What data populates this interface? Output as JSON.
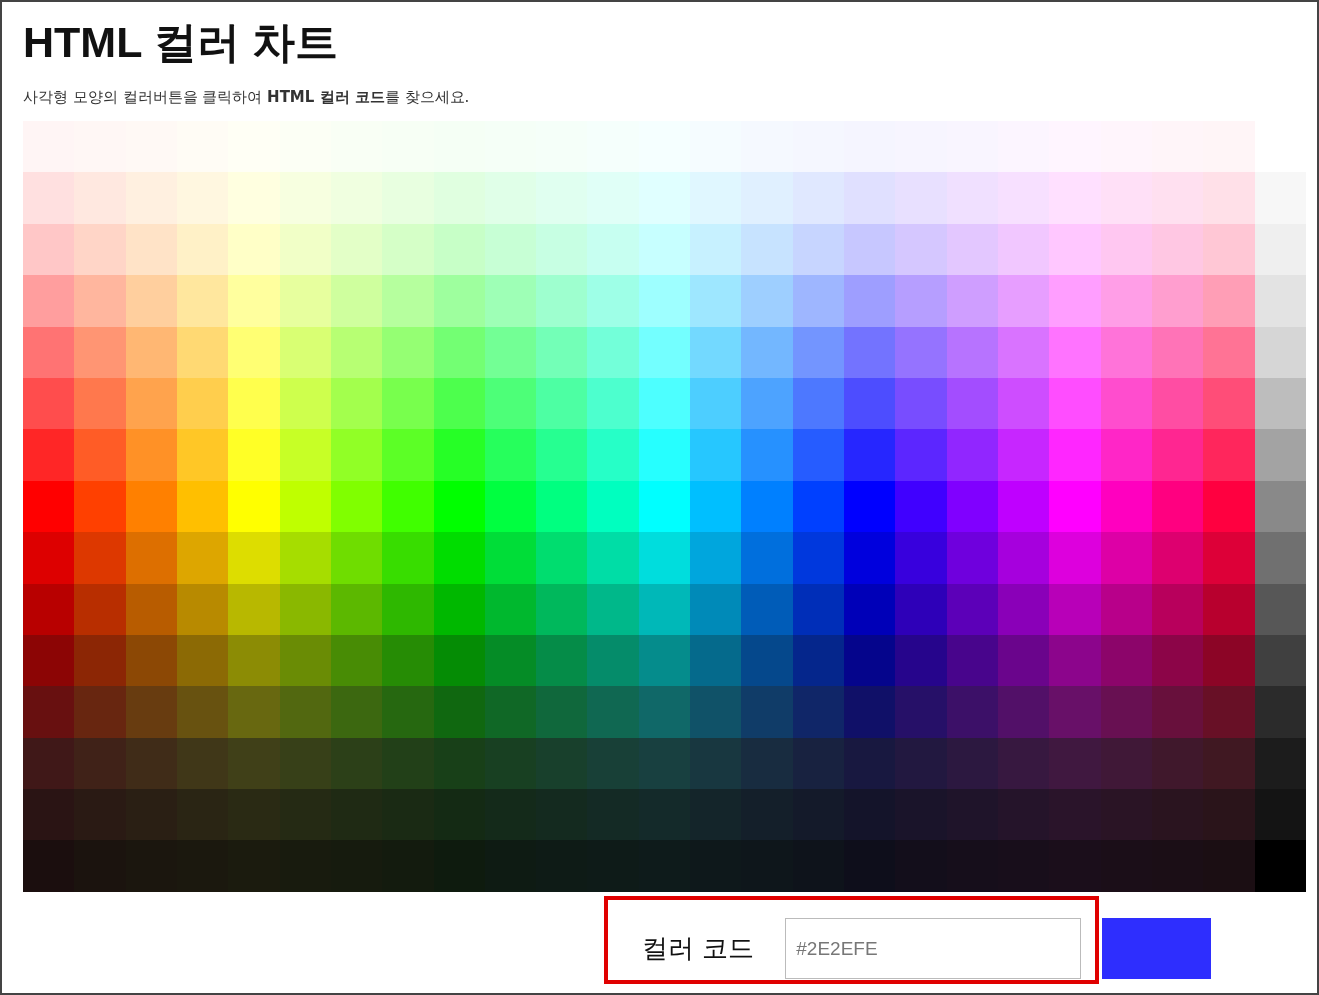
{
  "title": "HTML 컬러 차트",
  "description": "사각형 모양의 컬러버튼을 클릭하여 **HTML 컬러 코드**를 찾으세요.",
  "grid": {
    "rows": [
      {
        "swatches": [
          {
            "color": "#FFF5F5"
          },
          {
            "color": "#FFF7F5"
          },
          {
            "color": "#FFF9F5"
          },
          {
            "color": "#FFFCF5"
          },
          {
            "color": "#FFFFF5"
          },
          {
            "color": "#FCFFF5"
          },
          {
            "color": "#F9FFF5"
          },
          {
            "color": "#F7FFF5"
          },
          {
            "color": "#F5FFF5"
          },
          {
            "color": "#F5FFF7"
          },
          {
            "color": "#F5FFF9"
          },
          {
            "color": "#F5FFFC"
          },
          {
            "color": "#F5FFFF"
          },
          {
            "color": "#F5FCFF"
          },
          {
            "color": "#F5F9FF"
          },
          {
            "color": "#F5F7FF"
          },
          {
            "color": "#F5F5FF"
          },
          {
            "color": "#F7F5FF"
          },
          {
            "color": "#F9F5FF"
          },
          {
            "color": "#FCF5FF"
          },
          {
            "color": "#FFF5FF"
          },
          {
            "color": "#FFF5FC"
          },
          {
            "color": "#FFF5F9"
          },
          {
            "color": "#FFF5F7"
          }
        ]
      },
      {
        "swatches": [
          {
            "color": "#FFE0E0"
          },
          {
            "color": "#FFE8E0"
          },
          {
            "color": "#FFF0E0"
          },
          {
            "color": "#FFF7E0"
          },
          {
            "color": "#FFFFE0"
          },
          {
            "color": "#F7FFE0"
          },
          {
            "color": "#F0FFE0"
          },
          {
            "color": "#E8FFE0"
          },
          {
            "color": "#E0FFE0"
          },
          {
            "color": "#E0FFE8"
          },
          {
            "color": "#E0FFF0"
          },
          {
            "color": "#E0FFF7"
          },
          {
            "color": "#E0FFFF"
          },
          {
            "color": "#E0F7FF"
          },
          {
            "color": "#E0F0FF"
          },
          {
            "color": "#E0E8FF"
          },
          {
            "color": "#E0E0FF"
          },
          {
            "color": "#E8E0FF"
          },
          {
            "color": "#F0E0FF"
          },
          {
            "color": "#F7E0FF"
          },
          {
            "color": "#FFE0FF"
          },
          {
            "color": "#FFE0F7"
          },
          {
            "color": "#FFE0F0"
          },
          {
            "color": "#FFE0E8"
          },
          {
            "color": "#F7F7F7"
          }
        ]
      },
      {
        "swatches": [
          {
            "color": "#FFC7C7"
          },
          {
            "color": "#FFD5C7"
          },
          {
            "color": "#FFE3C7"
          },
          {
            "color": "#FFF1C7"
          },
          {
            "color": "#FFFFC7"
          },
          {
            "color": "#F1FFC7"
          },
          {
            "color": "#E3FFC7"
          },
          {
            "color": "#D5FFC7"
          },
          {
            "color": "#C7FFC7"
          },
          {
            "color": "#C7FFD5"
          },
          {
            "color": "#C7FFE3"
          },
          {
            "color": "#C7FFF1"
          },
          {
            "color": "#C7FFFF"
          },
          {
            "color": "#C7F1FF"
          },
          {
            "color": "#C7E3FF"
          },
          {
            "color": "#C7D5FF"
          },
          {
            "color": "#C7C7FF"
          },
          {
            "color": "#D5C7FF"
          },
          {
            "color": "#E3C7FF"
          },
          {
            "color": "#F1C7FF"
          },
          {
            "color": "#FFC7FF"
          },
          {
            "color": "#FFC7F1"
          },
          {
            "color": "#FFC7E3"
          },
          {
            "color": "#FFC7D5"
          },
          {
            "color": "#EFEFEF"
          }
        ]
      },
      {
        "swatches": [
          {
            "color": "#FF9E9E"
          },
          {
            "color": "#FFB69E"
          },
          {
            "color": "#FFCF9E"
          },
          {
            "color": "#FFE79E"
          },
          {
            "color": "#FFFF9E"
          },
          {
            "color": "#E7FF9E"
          },
          {
            "color": "#CFFF9E"
          },
          {
            "color": "#B6FF9E"
          },
          {
            "color": "#9EFF9E"
          },
          {
            "color": "#9EFFB6"
          },
          {
            "color": "#9EFFCF"
          },
          {
            "color": "#9EFFE7"
          },
          {
            "color": "#9EFFFF"
          },
          {
            "color": "#9EE7FF"
          },
          {
            "color": "#9ECFFF"
          },
          {
            "color": "#9EB6FF"
          },
          {
            "color": "#9E9EFF"
          },
          {
            "color": "#B69EFF"
          },
          {
            "color": "#CF9EFF"
          },
          {
            "color": "#E79EFF"
          },
          {
            "color": "#FF9EFF"
          },
          {
            "color": "#FF9EE7"
          },
          {
            "color": "#FF9ECF"
          },
          {
            "color": "#FF9EB6"
          },
          {
            "color": "#E3E3E3"
          }
        ]
      },
      {
        "swatches": [
          {
            "color": "#FF7373"
          },
          {
            "color": "#FF9573"
          },
          {
            "color": "#FFB773"
          },
          {
            "color": "#FFD973"
          },
          {
            "color": "#FFFF73"
          },
          {
            "color": "#D9FF73"
          },
          {
            "color": "#B7FF73"
          },
          {
            "color": "#95FF73"
          },
          {
            "color": "#73FF73"
          },
          {
            "color": "#73FF95"
          },
          {
            "color": "#73FFB7"
          },
          {
            "color": "#73FFD9"
          },
          {
            "color": "#73FFFF"
          },
          {
            "color": "#73D9FF"
          },
          {
            "color": "#73B7FF"
          },
          {
            "color": "#7395FF"
          },
          {
            "color": "#7373FF"
          },
          {
            "color": "#9573FF"
          },
          {
            "color": "#B773FF"
          },
          {
            "color": "#D973FF"
          },
          {
            "color": "#FF73FF"
          },
          {
            "color": "#FF73D9"
          },
          {
            "color": "#FF73B7"
          },
          {
            "color": "#FF7395"
          },
          {
            "color": "#D6D6D6"
          }
        ]
      },
      {
        "swatches": [
          {
            "color": "#FF4D4D"
          },
          {
            "color": "#FF784D"
          },
          {
            "color": "#FFA34D"
          },
          {
            "color": "#FFCE4D"
          },
          {
            "color": "#FFFF4D"
          },
          {
            "color": "#CEFF4D"
          },
          {
            "color": "#A3FF4D"
          },
          {
            "color": "#78FF4D"
          },
          {
            "color": "#4DFF4D"
          },
          {
            "color": "#4DFF78"
          },
          {
            "color": "#4DFFA3"
          },
          {
            "color": "#4DFFCE"
          },
          {
            "color": "#4DFFFF"
          },
          {
            "color": "#4DCEFF"
          },
          {
            "color": "#4DA3FF"
          },
          {
            "color": "#4D78FF"
          },
          {
            "color": "#4D4DFF"
          },
          {
            "color": "#784DFF"
          },
          {
            "color": "#A34DFF"
          },
          {
            "color": "#CE4DFF"
          },
          {
            "color": "#FF4DFF"
          },
          {
            "color": "#FF4DCE"
          },
          {
            "color": "#FF4DA3"
          },
          {
            "color": "#FF4D78"
          },
          {
            "color": "#BDBDBD"
          }
        ]
      },
      {
        "swatches": [
          {
            "color": "#FF2626"
          },
          {
            "color": "#FF5C26"
          },
          {
            "color": "#FF9126"
          },
          {
            "color": "#FFC726"
          },
          {
            "color": "#FFFF26"
          },
          {
            "color": "#C7FF26"
          },
          {
            "color": "#91FF26"
          },
          {
            "color": "#5CFF26"
          },
          {
            "color": "#26FF26"
          },
          {
            "color": "#26FF5C"
          },
          {
            "color": "#26FF91"
          },
          {
            "color": "#26FFC7"
          },
          {
            "color": "#26FFFF"
          },
          {
            "color": "#26C7FF"
          },
          {
            "color": "#2691FF"
          },
          {
            "color": "#265CFF"
          },
          {
            "color": "#2626FF"
          },
          {
            "color": "#5C26FF"
          },
          {
            "color": "#9126FF"
          },
          {
            "color": "#C726FF"
          },
          {
            "color": "#FF26FF"
          },
          {
            "color": "#FF26C7"
          },
          {
            "color": "#FF2691"
          },
          {
            "color": "#FF265C"
          },
          {
            "color": "#A3A3A3"
          }
        ]
      },
      {
        "swatches": [
          {
            "color": "#FF0000"
          },
          {
            "color": "#FF4000"
          },
          {
            "color": "#FF8000"
          },
          {
            "color": "#FFBF00"
          },
          {
            "color": "#FFFF00"
          },
          {
            "color": "#BFFF00"
          },
          {
            "color": "#80FF00"
          },
          {
            "color": "#40FF00"
          },
          {
            "color": "#00FF00"
          },
          {
            "color": "#00FF40"
          },
          {
            "color": "#00FF80"
          },
          {
            "color": "#00FFBF"
          },
          {
            "color": "#00FFFF"
          },
          {
            "color": "#00BFFF"
          },
          {
            "color": "#0080FF"
          },
          {
            "color": "#0040FF"
          },
          {
            "color": "#0000FF"
          },
          {
            "color": "#4000FF"
          },
          {
            "color": "#8000FF"
          },
          {
            "color": "#BF00FF"
          },
          {
            "color": "#FF00FF"
          },
          {
            "color": "#FF00BF"
          },
          {
            "color": "#FF0080"
          },
          {
            "color": "#FF0040"
          },
          {
            "color": "#898989"
          }
        ]
      },
      {
        "swatches": [
          {
            "color": "#DD0000"
          },
          {
            "color": "#DD3800"
          },
          {
            "color": "#DD6F00"
          },
          {
            "color": "#DDA600"
          },
          {
            "color": "#DDDD00"
          },
          {
            "color": "#A6DD00"
          },
          {
            "color": "#6FDD00"
          },
          {
            "color": "#38DD00"
          },
          {
            "color": "#00DD00"
          },
          {
            "color": "#00DD38"
          },
          {
            "color": "#00DD6F"
          },
          {
            "color": "#00DDA6"
          },
          {
            "color": "#00DDDD"
          },
          {
            "color": "#00A6DD"
          },
          {
            "color": "#006FDD"
          },
          {
            "color": "#0038DD"
          },
          {
            "color": "#0000DD"
          },
          {
            "color": "#3800DD"
          },
          {
            "color": "#6F00DD"
          },
          {
            "color": "#A600DD"
          },
          {
            "color": "#DD00DD"
          },
          {
            "color": "#DD00A6"
          },
          {
            "color": "#DD006F"
          },
          {
            "color": "#DD0038"
          },
          {
            "color": "#707070"
          }
        ]
      },
      {
        "swatches": [
          {
            "color": "#B80000"
          },
          {
            "color": "#B82E00"
          },
          {
            "color": "#B85C00"
          },
          {
            "color": "#B88A00"
          },
          {
            "color": "#B8B800"
          },
          {
            "color": "#8AB800"
          },
          {
            "color": "#5CB800"
          },
          {
            "color": "#2EB800"
          },
          {
            "color": "#00B800"
          },
          {
            "color": "#00B82E"
          },
          {
            "color": "#00B85C"
          },
          {
            "color": "#00B88A"
          },
          {
            "color": "#00B8B8"
          },
          {
            "color": "#008AB8"
          },
          {
            "color": "#005CB8"
          },
          {
            "color": "#002EB8"
          },
          {
            "color": "#0000B8"
          },
          {
            "color": "#2E00B8"
          },
          {
            "color": "#5C00B8"
          },
          {
            "color": "#8A00B8"
          },
          {
            "color": "#B800B8"
          },
          {
            "color": "#B8008A"
          },
          {
            "color": "#B8005C"
          },
          {
            "color": "#B8002E"
          },
          {
            "color": "#575757"
          }
        ]
      },
      {
        "swatches": [
          {
            "color": "#8C0505"
          },
          {
            "color": "#8C2605"
          },
          {
            "color": "#8C4805"
          },
          {
            "color": "#8C6A05"
          },
          {
            "color": "#8C8C05"
          },
          {
            "color": "#6A8C05"
          },
          {
            "color": "#488C05"
          },
          {
            "color": "#268C05"
          },
          {
            "color": "#058C05"
          },
          {
            "color": "#058C26"
          },
          {
            "color": "#058C48"
          },
          {
            "color": "#058C6A"
          },
          {
            "color": "#058C8C"
          },
          {
            "color": "#056A8C"
          },
          {
            "color": "#05488C"
          },
          {
            "color": "#05268C"
          },
          {
            "color": "#05058C"
          },
          {
            "color": "#26058C"
          },
          {
            "color": "#48058C"
          },
          {
            "color": "#6A058C"
          },
          {
            "color": "#8C058C"
          },
          {
            "color": "#8C056A"
          },
          {
            "color": "#8C0548"
          },
          {
            "color": "#8C0526"
          },
          {
            "color": "#404040"
          }
        ]
      },
      {
        "swatches": [
          {
            "color": "#681010"
          },
          {
            "color": "#682610"
          },
          {
            "color": "#683C10"
          },
          {
            "color": "#685210"
          },
          {
            "color": "#686810"
          },
          {
            "color": "#526810"
          },
          {
            "color": "#3C6810"
          },
          {
            "color": "#266810"
          },
          {
            "color": "#106810"
          },
          {
            "color": "#106826"
          },
          {
            "color": "#10683C"
          },
          {
            "color": "#106852"
          },
          {
            "color": "#106868"
          },
          {
            "color": "#105268"
          },
          {
            "color": "#103C68"
          },
          {
            "color": "#102668"
          },
          {
            "color": "#101068"
          },
          {
            "color": "#261068"
          },
          {
            "color": "#3C1068"
          },
          {
            "color": "#521068"
          },
          {
            "color": "#681068"
          },
          {
            "color": "#681052"
          },
          {
            "color": "#68103C"
          },
          {
            "color": "#681026"
          },
          {
            "color": "#2B2B2B"
          }
        ]
      },
      {
        "swatches": [
          {
            "color": "#401818"
          },
          {
            "color": "#402218"
          },
          {
            "color": "#402C18"
          },
          {
            "color": "#403718"
          },
          {
            "color": "#404018"
          },
          {
            "color": "#374018"
          },
          {
            "color": "#2C4018"
          },
          {
            "color": "#224018"
          },
          {
            "color": "#184018"
          },
          {
            "color": "#184022"
          },
          {
            "color": "#18402C"
          },
          {
            "color": "#184037"
          },
          {
            "color": "#184040"
          },
          {
            "color": "#183740"
          },
          {
            "color": "#182C40"
          },
          {
            "color": "#182240"
          },
          {
            "color": "#181840"
          },
          {
            "color": "#221840"
          },
          {
            "color": "#2C1840"
          },
          {
            "color": "#371840"
          },
          {
            "color": "#401840"
          },
          {
            "color": "#401837"
          },
          {
            "color": "#40182C"
          },
          {
            "color": "#401822"
          },
          {
            "color": "#1C1C1C"
          }
        ]
      },
      {
        "swatches": [
          {
            "color": "#2A1414"
          },
          {
            "color": "#2A1A14"
          },
          {
            "color": "#2A1F14"
          },
          {
            "color": "#2A2514"
          },
          {
            "color": "#2A2A14"
          },
          {
            "color": "#252A14"
          },
          {
            "color": "#1F2A14"
          },
          {
            "color": "#1A2A14"
          },
          {
            "color": "#142A14"
          },
          {
            "color": "#142A1A"
          },
          {
            "color": "#142A1F"
          },
          {
            "color": "#142A25"
          },
          {
            "color": "#142A2A"
          },
          {
            "color": "#14252A"
          },
          {
            "color": "#141F2A"
          },
          {
            "color": "#141A2A"
          },
          {
            "color": "#14142A"
          },
          {
            "color": "#1A142A"
          },
          {
            "color": "#1F142A"
          },
          {
            "color": "#25142A"
          },
          {
            "color": "#2A142A"
          },
          {
            "color": "#2A1425"
          },
          {
            "color": "#2A141F"
          },
          {
            "color": "#2A141A"
          },
          {
            "color": "#141414"
          }
        ]
      },
      {
        "swatches": [
          {
            "color": "#1B0E0E"
          },
          {
            "color": "#1B130E"
          },
          {
            "color": "#1B160E"
          },
          {
            "color": "#1B180E"
          },
          {
            "color": "#1B1B0E"
          },
          {
            "color": "#181B0E"
          },
          {
            "color": "#161B0E"
          },
          {
            "color": "#131B0E"
          },
          {
            "color": "#0E1B0E"
          },
          {
            "color": "#0E1B13"
          },
          {
            "color": "#0E1B16"
          },
          {
            "color": "#0E1B18"
          },
          {
            "color": "#0E1B1B"
          },
          {
            "color": "#0E181B"
          },
          {
            "color": "#0E161B"
          },
          {
            "color": "#0E131B"
          },
          {
            "color": "#0E0E1B"
          },
          {
            "color": "#130E1B"
          },
          {
            "color": "#160E1B"
          },
          {
            "color": "#180E1B"
          },
          {
            "color": "#1B0E1B"
          },
          {
            "color": "#1B0E18"
          },
          {
            "color": "#1B0E16"
          },
          {
            "color": "#1B0E13"
          },
          {
            "color": "#000000"
          }
        ]
      }
    ]
  },
  "code_panel": {
    "label": "컬러 코드",
    "value": "#2E2EFE",
    "preview": {
      "color": "#2E2EFE"
    }
  }
}
